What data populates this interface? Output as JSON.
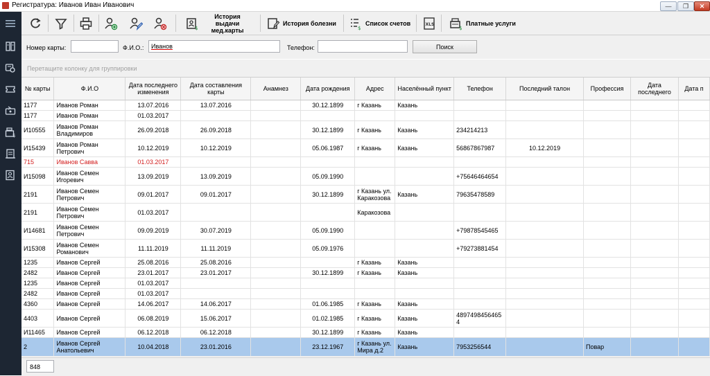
{
  "window": {
    "title": "Регистратура: Иванов Иван Иванович",
    "controls": [
      "minimize",
      "restore",
      "close"
    ]
  },
  "sidebar": {
    "items": [
      {
        "icon": "hamburger-menu-icon"
      },
      {
        "icon": "registry-icon"
      },
      {
        "icon": "doctor-icon"
      },
      {
        "icon": "ticket-icon"
      },
      {
        "icon": "transfer-icon"
      },
      {
        "icon": "cash-register-icon"
      },
      {
        "icon": "schedule-icon"
      },
      {
        "icon": "patient-card-icon"
      }
    ]
  },
  "toolbar": {
    "buttons": [
      {
        "icon": "refresh-icon",
        "label": ""
      },
      {
        "icon": "filter-icon",
        "label": ""
      },
      {
        "icon": "print-icon",
        "label": ""
      },
      {
        "icon": "add-user-icon",
        "label": ""
      },
      {
        "icon": "edit-user-icon",
        "label": ""
      },
      {
        "icon": "delete-user-icon",
        "label": ""
      },
      {
        "icon": "card-history-icon",
        "label": "История выдачи\nмед.карты"
      },
      {
        "icon": "disease-history-icon",
        "label": "История болезни"
      },
      {
        "icon": "invoice-list-icon",
        "label": "Список счетов"
      },
      {
        "icon": "xls-export-icon",
        "label": ""
      },
      {
        "icon": "paid-services-icon",
        "label": "Платные услуги"
      }
    ]
  },
  "search": {
    "card_label": "Номер карты:",
    "card_value": "",
    "name_label": "Ф.И.О.:",
    "name_value": "Иванов",
    "phone_label": "Телефон:",
    "phone_value": "",
    "search_button": "Поиск"
  },
  "grouping_hint": "Перетащите колонку для группировки",
  "table": {
    "columns": [
      "№ карты",
      "Ф.И.О",
      "Дата последнего изменения",
      "Дата составления карты",
      "Анамнез",
      "Дата рождения",
      "Адрес",
      "Населённый пункт",
      "Телефон",
      "Последний талон",
      "Профессия",
      "Дата последнего",
      "Дата п"
    ],
    "rows": [
      {
        "style": "",
        "cells": [
          "1177",
          "Иванов Роман",
          "13.07.2016",
          "13.07.2016",
          "",
          "30.12.1899",
          "г Казань",
          "Казань",
          "",
          "",
          "",
          "",
          ""
        ]
      },
      {
        "style": "",
        "cells": [
          "1177",
          "Иванов Роман",
          "01.03.2017",
          "",
          "",
          "",
          "",
          "",
          "",
          "",
          "",
          "",
          ""
        ]
      },
      {
        "style": "",
        "cells": [
          "И10555",
          "Иванов Роман Владимиров",
          "26.09.2018",
          "26.09.2018",
          "",
          "30.12.1899",
          "г Казань",
          "Казань",
          "234214213",
          "",
          "",
          "",
          ""
        ]
      },
      {
        "style": "",
        "cells": [
          "И15439",
          "Иванов Роман Петрович",
          "10.12.2019",
          "10.12.2019",
          "",
          "05.06.1987",
          "г Казань",
          "Казань",
          "56867867987",
          "10.12.2019",
          "",
          "",
          ""
        ]
      },
      {
        "style": "red",
        "cells": [
          "715",
          "Иванов Савва",
          "01.03.2017",
          "",
          "",
          "",
          "",
          "",
          "",
          "",
          "",
          "",
          ""
        ]
      },
      {
        "style": "",
        "cells": [
          "И15098",
          "Иванов Семен Игоревич",
          "13.09.2019",
          "13.09.2019",
          "",
          "05.09.1990",
          "",
          "",
          "+75646464654",
          "",
          "",
          "",
          ""
        ]
      },
      {
        "style": "",
        "cells": [
          "2191",
          "Иванов Семен Петрович",
          "09.01.2017",
          "09.01.2017",
          "",
          "30.12.1899",
          "г Казань ул. Каракозова",
          "Казань",
          "79635478589",
          "",
          "",
          "",
          ""
        ]
      },
      {
        "style": "",
        "cells": [
          "2191",
          "Иванов Семен Петрович",
          "01.03.2017",
          "",
          "",
          "",
          "Каракозова",
          "",
          "",
          "",
          "",
          "",
          ""
        ]
      },
      {
        "style": "",
        "cells": [
          "И14681",
          "Иванов Семен Петрович",
          "09.09.2019",
          "30.07.2019",
          "",
          "05.09.1990",
          "",
          "",
          "+79878545465",
          "",
          "",
          "",
          ""
        ]
      },
      {
        "style": "",
        "cells": [
          "И15308",
          "Иванов Семен Романович",
          "11.11.2019",
          "11.11.2019",
          "",
          "05.09.1976",
          "",
          "",
          "+79273881454",
          "",
          "",
          "",
          ""
        ]
      },
      {
        "style": "",
        "cells": [
          "1235",
          "Иванов Сергей",
          "25.08.2016",
          "25.08.2016",
          "",
          "",
          "г Казань",
          "Казань",
          "",
          "",
          "",
          "",
          ""
        ]
      },
      {
        "style": "",
        "cells": [
          "2482",
          "Иванов Сергей",
          "23.01.2017",
          "23.01.2017",
          "",
          "30.12.1899",
          "г Казань",
          "Казань",
          "",
          "",
          "",
          "",
          ""
        ]
      },
      {
        "style": "",
        "cells": [
          "1235",
          "Иванов Сергей",
          "01.03.2017",
          "",
          "",
          "",
          "",
          "",
          "",
          "",
          "",
          "",
          ""
        ]
      },
      {
        "style": "",
        "cells": [
          "2482",
          "Иванов Сергей",
          "01.03.2017",
          "",
          "",
          "",
          "",
          "",
          "",
          "",
          "",
          "",
          ""
        ]
      },
      {
        "style": "",
        "cells": [
          "4360",
          "Иванов Сергей",
          "14.06.2017",
          "14.06.2017",
          "",
          "01.06.1985",
          "г Казань",
          "Казань",
          "",
          "",
          "",
          "",
          ""
        ]
      },
      {
        "style": "",
        "cells": [
          "4403",
          "Иванов Сергей",
          "06.08.2019",
          "15.06.2017",
          "",
          "01.02.1985",
          "г Казань",
          "Казань",
          "48974984564654",
          "",
          "",
          "",
          ""
        ]
      },
      {
        "style": "",
        "cells": [
          "И11465",
          "Иванов Сергей",
          "06.12.2018",
          "06.12.2018",
          "",
          "30.12.1899",
          "г Казань",
          "Казань",
          "",
          "",
          "",
          "",
          ""
        ]
      },
      {
        "style": "sel",
        "cells": [
          "2",
          "Иванов Сергей Анатольевич",
          "10.04.2018",
          "23.01.2016",
          "",
          "23.12.1967",
          "г Казань ул. Мира д.2",
          "Казань",
          "7953256544",
          "",
          "Повар",
          "",
          ""
        ]
      }
    ]
  },
  "footer": {
    "record_count": "848"
  },
  "colors": {
    "sidebar_bg": "#1d2633",
    "selected_row": "#a9c9ec",
    "highlight_text": "#d21d1d"
  }
}
